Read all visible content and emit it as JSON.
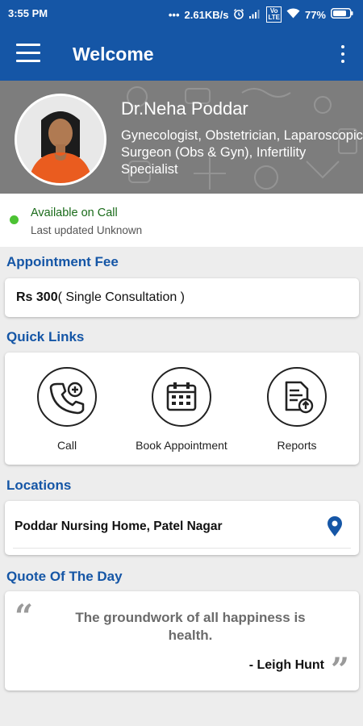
{
  "status_bar": {
    "time": "3:55 PM",
    "speed": "2.61KB/s",
    "battery": "77%",
    "icons": [
      "dots-icon",
      "alarm-icon",
      "signal-icon",
      "volte-icon",
      "wifi-icon",
      "battery-icon"
    ]
  },
  "app_bar": {
    "title": "Welcome",
    "menu_icon": "hamburger-icon",
    "overflow_icon": "kebab-icon",
    "color": "#1556a6"
  },
  "profile": {
    "name": "Dr.Neha Poddar",
    "specialty": "Gynecologist, Obstetrician, Laparoscopic Surgeon (Obs & Gyn), Infertility Specialist"
  },
  "availability": {
    "status": "Available on Call",
    "last_updated": "Last updated Unknown",
    "status_color": "#4cc233"
  },
  "appointment_fee": {
    "heading": "Appointment Fee",
    "amount": "Rs 300",
    "detail": "( Single Consultation )"
  },
  "quick_links": {
    "heading": "Quick Links",
    "items": [
      {
        "label": "Call",
        "icon": "phone-plus-icon"
      },
      {
        "label": "Book Appointment",
        "icon": "calendar-icon"
      },
      {
        "label": "Reports",
        "icon": "report-upload-icon"
      }
    ]
  },
  "locations": {
    "heading": "Locations",
    "items": [
      {
        "name": "Poddar Nursing Home, Patel Nagar",
        "icon": "map-pin-icon"
      }
    ]
  },
  "quote": {
    "heading": "Quote Of The Day",
    "text": "The groundwork of all happiness is health.",
    "author": "- Leigh Hunt"
  }
}
